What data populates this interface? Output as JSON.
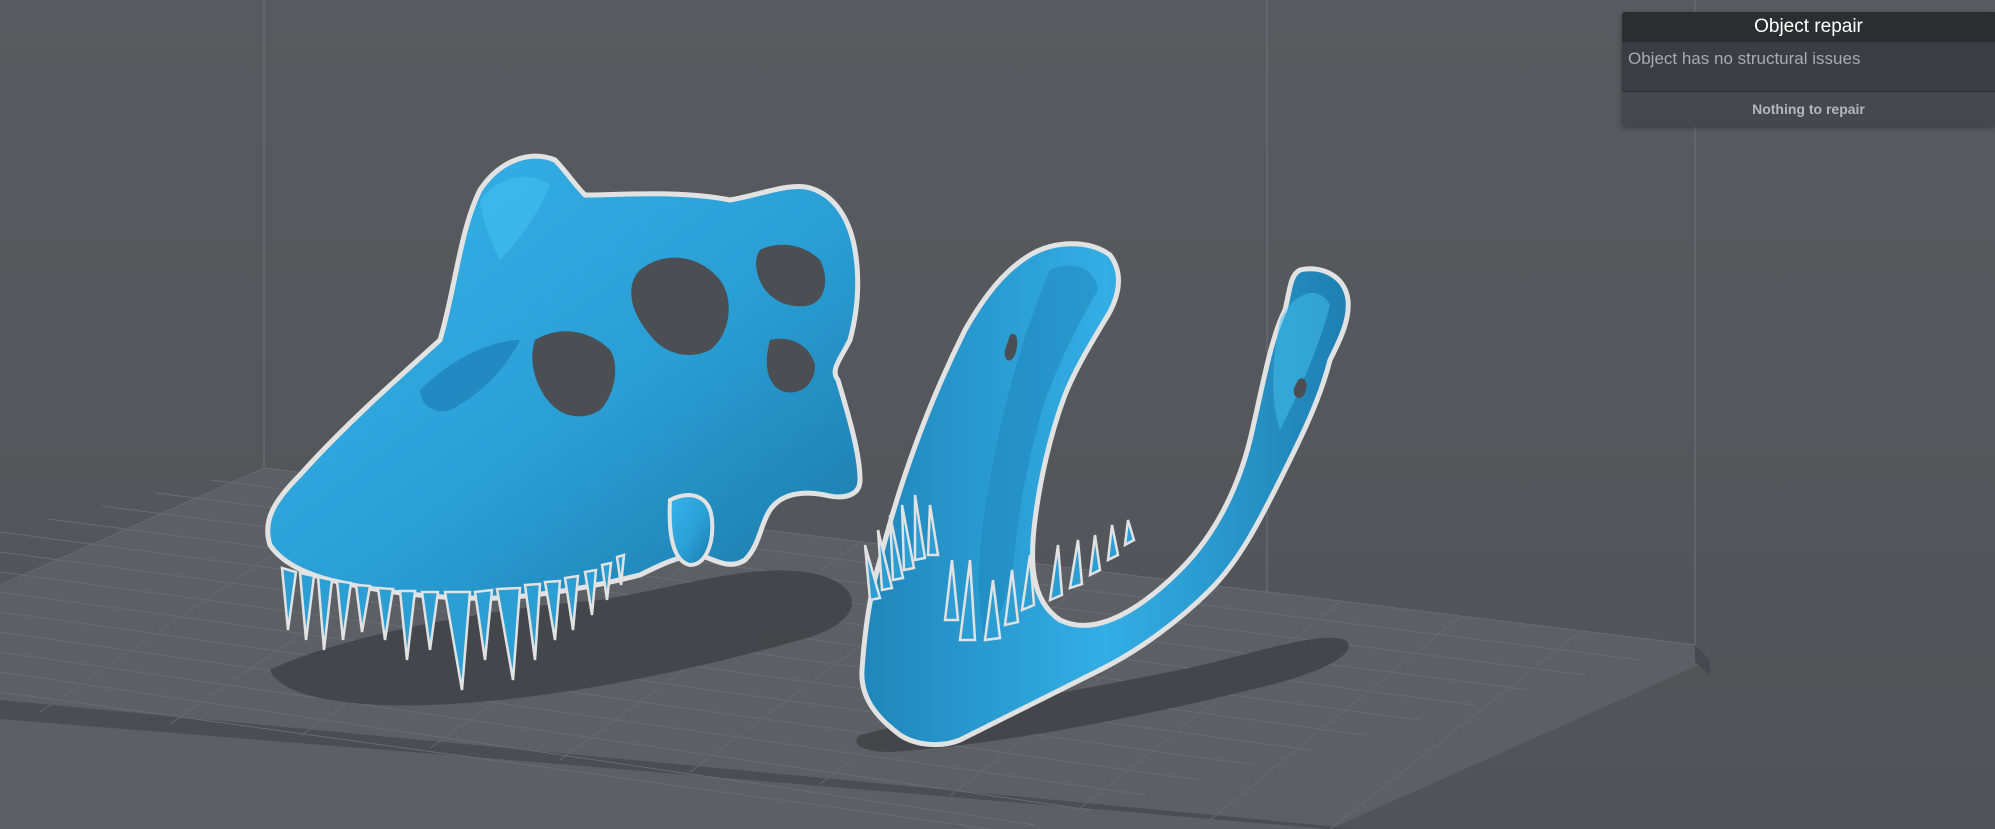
{
  "repair_panel": {
    "title": "Object repair",
    "status_text": "Object has no structural issues",
    "action_label": "Nothing to repair"
  },
  "colors": {
    "viewport_background": "#55585c",
    "model_color": "#2a9fd6",
    "model_outline": "#e6e6e6",
    "panel_header": "#2b2d30",
    "panel_body": "#3a3d41"
  },
  "icons": [
    "skull-model",
    "jaw-model",
    "build-plate-grid"
  ]
}
